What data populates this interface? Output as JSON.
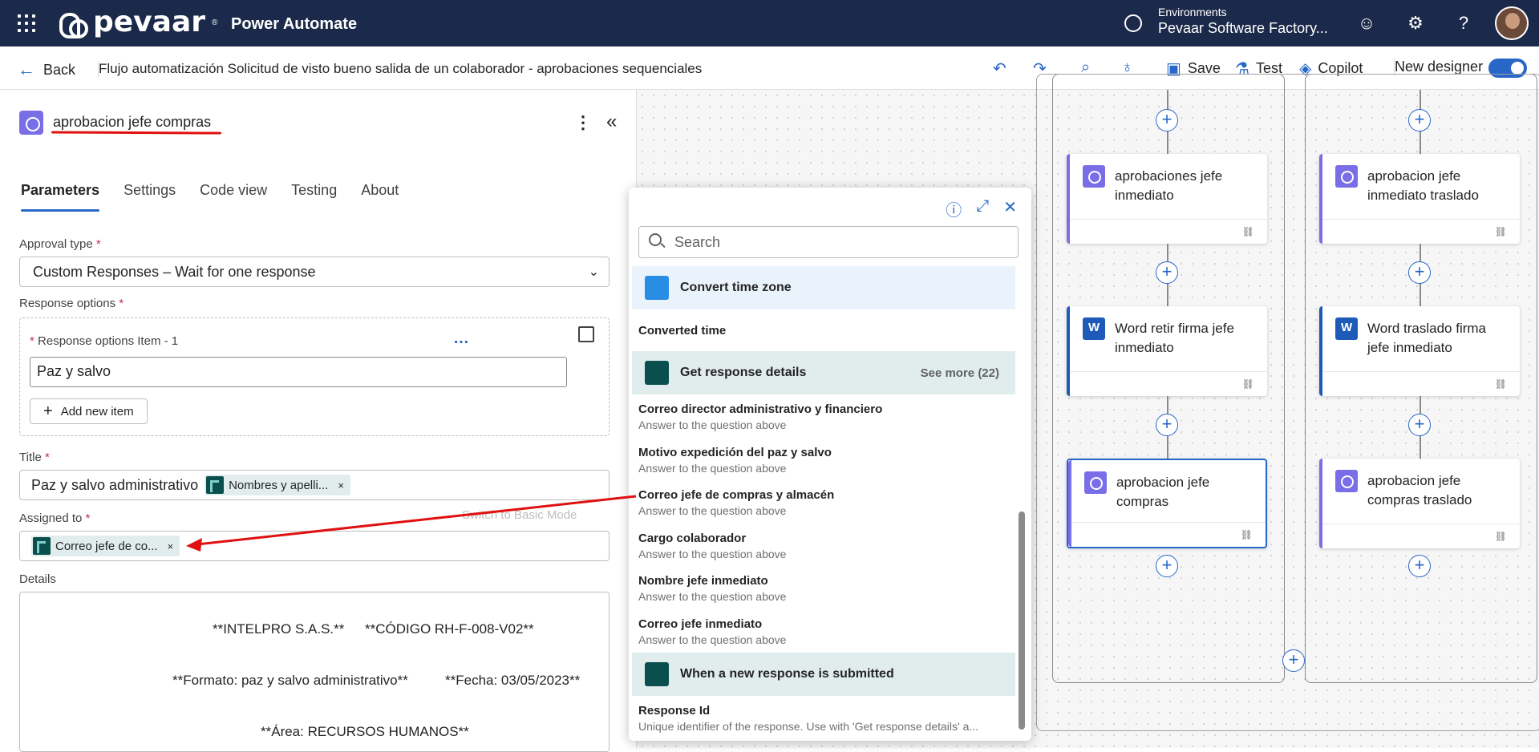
{
  "topbar": {
    "brand": "pevaar",
    "app_title": "Power Automate",
    "env_label": "Environments",
    "env_value": "Pevaar Software Factory...",
    "icons": [
      "apps-grid-icon",
      "globe-icon",
      "smiley-icon",
      "gear-icon",
      "help-icon"
    ]
  },
  "cmdbar": {
    "back_label": "Back",
    "flow_name": "Flujo automatización Solicitud de visto bueno salida de un colaborador - aprobaciones sequenciales",
    "save_label": "Save",
    "test_label": "Test",
    "copilot_label": "Copilot",
    "new_designer_label": "New designer",
    "new_designer_on": true
  },
  "panel": {
    "title": "aprobacion jefe compras",
    "tabs": [
      "Parameters",
      "Settings",
      "Code view",
      "Testing",
      "About"
    ],
    "approval_type_label": "Approval type",
    "approval_type_value": "Custom Responses – Wait for one response",
    "response_options_label": "Response options",
    "response_item_label": "Response options Item - 1",
    "response_item_value": "Paz y salvo",
    "add_new_item": "Add new item",
    "title_label": "Title",
    "title_text": "Paz y salvo administrativo",
    "title_chip": "Nombres y apelli...",
    "switch_basic": "Switch to Basic Mode",
    "assigned_label": "Assigned to",
    "assigned_chip": "Correo jefe de co...",
    "details_label": "Details",
    "details_lines": [
      "**INTELPRO S.A.S.**",
      "**CÓDIGO RH-F-008-V02**",
      "**Formato: paz y salvo administrativo**",
      "**Fecha: 03/05/2023**",
      "**Área: RECURSOS HUMANOS**"
    ]
  },
  "popup": {
    "search_placeholder": "Search",
    "group1": "Convert time zone",
    "group1_item": "Converted time",
    "group2": "Get response details",
    "group2_more": "See more (22)",
    "items": [
      {
        "title": "Correo director administrativo y financiero",
        "sub": "Answer to the question above"
      },
      {
        "title": "Motivo expedición del paz y salvo",
        "sub": "Answer to the question above"
      },
      {
        "title": "Correo jefe de compras y almacén",
        "sub": "Answer to the question above"
      },
      {
        "title": "Cargo colaborador",
        "sub": "Answer to the question above"
      },
      {
        "title": "Nombre jefe inmediato",
        "sub": "Answer to the question above"
      },
      {
        "title": "Correo jefe inmediato",
        "sub": "Answer to the question above"
      }
    ],
    "group3": "When a new response is submitted",
    "group3_item_title": "Response Id",
    "group3_item_sub": "Unique identifier of the response. Use with 'Get response details' a..."
  },
  "canvas": {
    "nodes": [
      {
        "label": "aprobaciones jefe inmediato",
        "type": "approval"
      },
      {
        "label": "Word retir firma jefe inmediato",
        "type": "word"
      },
      {
        "label": "aprobacion jefe compras",
        "type": "approval",
        "selected": true
      },
      {
        "label": "aprobacion jefe inmediato traslado",
        "type": "approval"
      },
      {
        "label": "Word traslado firma jefe inmediato",
        "type": "word"
      },
      {
        "label": "aprobacion jefe compras traslado",
        "type": "approval"
      }
    ]
  },
  "colors": {
    "topbar": "#1b2a4a",
    "accent": "#2867c8",
    "approval": "#7a6ee8",
    "forms": "#0b4e4e",
    "annotation": "#e01010"
  }
}
